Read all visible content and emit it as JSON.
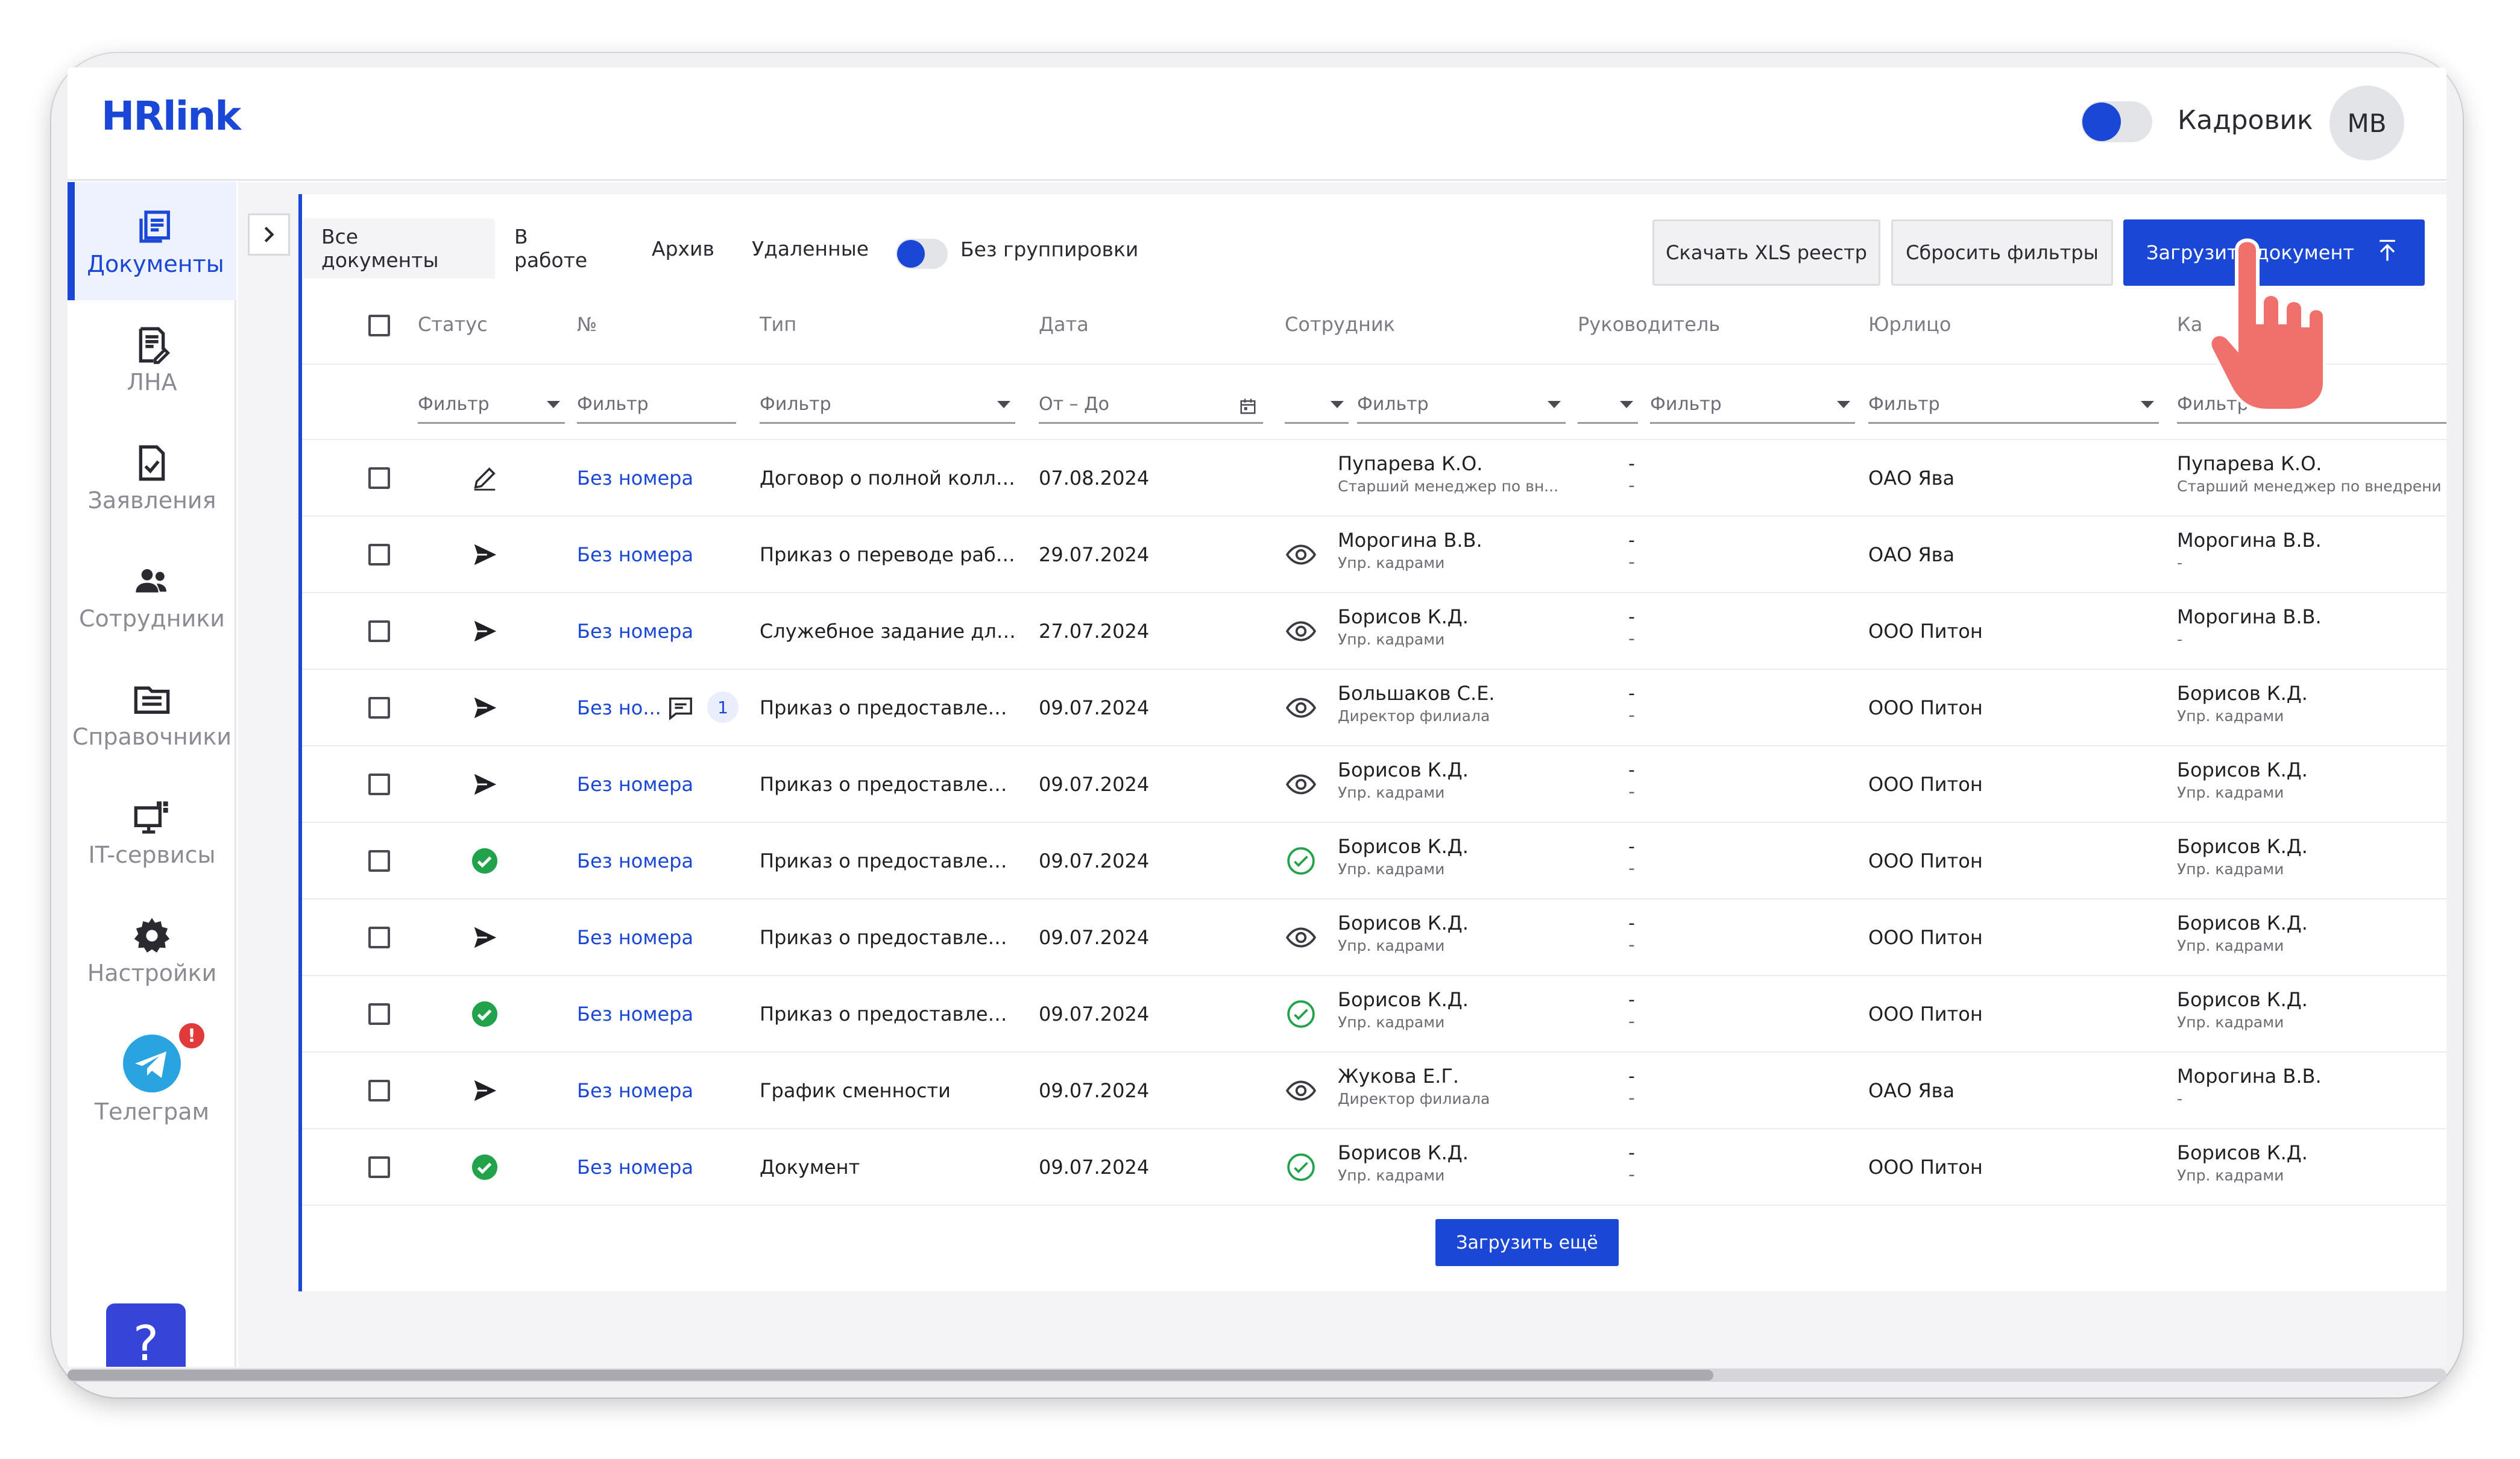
{
  "header": {
    "logo": "HRlink",
    "role_label": "Кадровик",
    "avatar_initials": "МВ"
  },
  "sidebar": {
    "items": [
      {
        "label": "Документы",
        "icon": "documents-icon",
        "active": true
      },
      {
        "label": "ЛНА",
        "icon": "lna-icon",
        "active": false
      },
      {
        "label": "Заявления",
        "icon": "applications-icon",
        "active": false
      },
      {
        "label": "Сотрудники",
        "icon": "employees-icon",
        "active": false
      },
      {
        "label": "Справочники",
        "icon": "directories-icon",
        "active": false
      },
      {
        "label": "IT-сервисы",
        "icon": "it-services-icon",
        "active": false
      },
      {
        "label": "Настройки",
        "icon": "gear-icon",
        "active": false
      },
      {
        "label": "Телеграм",
        "icon": "telegram-icon",
        "active": false,
        "badge": "!"
      }
    ],
    "help_label": "?"
  },
  "tabs": [
    "Все документы",
    "В работе",
    "Архив",
    "Удаленные"
  ],
  "grouping_label": "Без группировки",
  "actions": {
    "download_xls": "Скачать XLS реестр",
    "reset_filters": "Сбросить фильтры",
    "upload_document": "Загрузить документ"
  },
  "columns": [
    "Статус",
    "№",
    "Тип",
    "Дата",
    "Сотрудник",
    "Руководитель",
    "Юрлицо",
    "Ка"
  ],
  "filters": {
    "status": "Фильтр",
    "number": "Фильтр",
    "type": "Фильтр",
    "date": "От – До",
    "employee": "Фильтр",
    "manager": "Фильтр",
    "org": "Фильтр",
    "hr": "Фильтр"
  },
  "rows": [
    {
      "status": "draft",
      "number": "Без номера",
      "type": "Договор о полной коллек...",
      "date": "07.08.2024",
      "viewed": "none",
      "emp_name": "Пупарева К.О.",
      "emp_pos": "Старший менеджер по вн...",
      "mgr": "-",
      "mgr_pos": "-",
      "org": "ОАО Ява",
      "hr_name": "Пупарева К.О.",
      "hr_pos": "Старший менеджер по внедрени"
    },
    {
      "status": "sent",
      "number": "Без номера",
      "type": "Приказ о переводе работ...",
      "date": "29.07.2024",
      "viewed": "eye",
      "emp_name": "Морогина В.В.",
      "emp_pos": "Упр. кадрами",
      "mgr": "-",
      "mgr_pos": "-",
      "org": "ОАО Ява",
      "hr_name": "Морогина В.В.",
      "hr_pos": "-"
    },
    {
      "status": "sent",
      "number": "Без номера",
      "type": "Служебное задание для ...",
      "date": "27.07.2024",
      "viewed": "eye",
      "emp_name": "Борисов К.Д.",
      "emp_pos": "Упр. кадрами",
      "mgr": "-",
      "mgr_pos": "-",
      "org": "ООО Питон",
      "hr_name": "Морогина В.В.",
      "hr_pos": "-"
    },
    {
      "status": "sent",
      "number": "Без но...",
      "comments": "1",
      "type": "Приказ о предоставлени...",
      "date": "09.07.2024",
      "viewed": "eye",
      "emp_name": "Большаков С.Е.",
      "emp_pos": "Директор филиала",
      "mgr": "-",
      "mgr_pos": "-",
      "org": "ООО Питон",
      "hr_name": "Борисов К.Д.",
      "hr_pos": "Упр. кадрами"
    },
    {
      "status": "sent",
      "number": "Без номера",
      "type": "Приказ о предоставлени...",
      "date": "09.07.2024",
      "viewed": "eye",
      "emp_name": "Борисов К.Д.",
      "emp_pos": "Упр. кадрами",
      "mgr": "-",
      "mgr_pos": "-",
      "org": "ООО Питон",
      "hr_name": "Борисов К.Д.",
      "hr_pos": "Упр. кадрами"
    },
    {
      "status": "signed",
      "number": "Без номера",
      "type": "Приказ о предоставлени...",
      "date": "09.07.2024",
      "viewed": "check",
      "emp_name": "Борисов К.Д.",
      "emp_pos": "Упр. кадрами",
      "mgr": "-",
      "mgr_pos": "-",
      "org": "ООО Питон",
      "hr_name": "Борисов К.Д.",
      "hr_pos": "Упр. кадрами"
    },
    {
      "status": "sent",
      "number": "Без номера",
      "type": "Приказ о предоставлени...",
      "date": "09.07.2024",
      "viewed": "eye",
      "emp_name": "Борисов К.Д.",
      "emp_pos": "Упр. кадрами",
      "mgr": "-",
      "mgr_pos": "-",
      "org": "ООО Питон",
      "hr_name": "Борисов К.Д.",
      "hr_pos": "Упр. кадрами"
    },
    {
      "status": "signed",
      "number": "Без номера",
      "type": "Приказ о предоставлени...",
      "date": "09.07.2024",
      "viewed": "check",
      "emp_name": "Борисов К.Д.",
      "emp_pos": "Упр. кадрами",
      "mgr": "-",
      "mgr_pos": "-",
      "org": "ООО Питон",
      "hr_name": "Борисов К.Д.",
      "hr_pos": "Упр. кадрами"
    },
    {
      "status": "sent",
      "number": "Без номера",
      "type": "График сменности",
      "date": "09.07.2024",
      "viewed": "eye",
      "emp_name": "Жукова Е.Г.",
      "emp_pos": "Директор филиала",
      "mgr": "-",
      "mgr_pos": "-",
      "org": "ОАО Ява",
      "hr_name": "Морогина В.В.",
      "hr_pos": "-"
    },
    {
      "status": "signed",
      "number": "Без номера",
      "type": "Документ",
      "date": "09.07.2024",
      "viewed": "check",
      "emp_name": "Борисов К.Д.",
      "emp_pos": "Упр. кадрами",
      "mgr": "-",
      "mgr_pos": "-",
      "org": "ООО Питон",
      "hr_name": "Борисов К.Д.",
      "hr_pos": "Упр. кадрами"
    }
  ],
  "load_more": "Загрузить ещё",
  "colors": {
    "accent": "#1a47d6",
    "success": "#22a24a",
    "telegram": "#2aa3e1",
    "badge": "#e23a3a"
  }
}
